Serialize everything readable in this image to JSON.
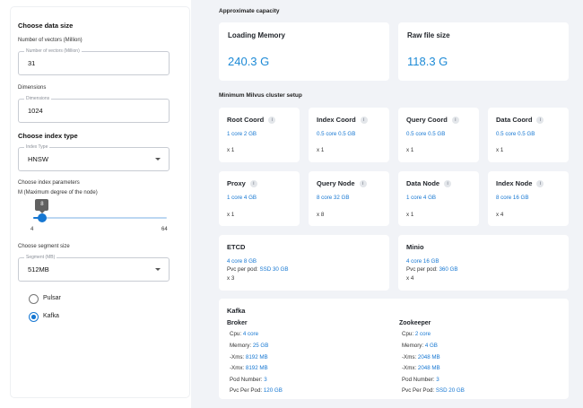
{
  "left": {
    "data_size_title": "Choose data size",
    "vectors_label": "Number of vectors (Million)",
    "vectors_legend": "Number of vectors (Million)",
    "vectors_value": "31",
    "dimensions_label": "Dimensions",
    "dimensions_legend": "Dimensions",
    "dimensions_value": "1024",
    "index_type_title": "Choose index type",
    "index_type_legend": "Index Type",
    "index_type_value": "HNSW",
    "index_params_label": "Choose index parameters",
    "m_label": "M (Maximum degree of the node)",
    "m_value": "8",
    "m_value_fraction": 0.067,
    "m_min": "4",
    "m_max": "64",
    "segment_label": "Choose segment size",
    "segment_legend": "Segment (MB)",
    "segment_value": "512MB",
    "mq_options": [
      {
        "label": "Pulsar",
        "selected": false
      },
      {
        "label": "Kafka",
        "selected": true
      }
    ]
  },
  "right": {
    "capacity_title": "Approximate capacity",
    "loading_memory": {
      "name": "Loading Memory",
      "value": "240.3 G"
    },
    "raw_file_size": {
      "name": "Raw file size",
      "value": "118.3 G"
    },
    "cluster_title": "Minimum Milvus cluster setup",
    "nodes": [
      {
        "name": "Root Coord",
        "spec": "1 core 2 GB",
        "count": "x 1"
      },
      {
        "name": "Index Coord",
        "spec": "0.5 core 0.5 GB",
        "count": "x 1"
      },
      {
        "name": "Query Coord",
        "spec": "0.5 core 0.5 GB",
        "count": "x 1"
      },
      {
        "name": "Data Coord",
        "spec": "0.5 core 0.5 GB",
        "count": "x 1"
      },
      {
        "name": "Proxy",
        "spec": "1 core 4 GB",
        "count": "x 1"
      },
      {
        "name": "Query Node",
        "spec": "8 core 32 GB",
        "count": "x 8"
      },
      {
        "name": "Data Node",
        "spec": "1 core 4 GB",
        "count": "x 1"
      },
      {
        "name": "Index Node",
        "spec": "8 core 16 GB",
        "count": "x 4"
      }
    ],
    "etcd": {
      "name": "ETCD",
      "spec": "4 core 8 GB",
      "pvc_label": "Pvc per pod:",
      "pvc_value": "SSD 30 GB",
      "count": "x 3"
    },
    "minio": {
      "name": "Minio",
      "spec": "4 core 16 GB",
      "pvc_label": "Pvc per pod:",
      "pvc_value": "360 GB",
      "count": "x 4"
    },
    "kafka": {
      "title": "Kafka",
      "broker": {
        "title": "Broker",
        "rows": [
          {
            "label": "Cpu:",
            "value": "4 core"
          },
          {
            "label": "Memory:",
            "value": "25 GB"
          },
          {
            "label": "-Xms:",
            "value": "8192 MB"
          },
          {
            "label": "-Xmx:",
            "value": "8192 MB"
          },
          {
            "label": "Pod Number:",
            "value": "3"
          },
          {
            "label": "Pvc Per Pod:",
            "value": "120 GB"
          }
        ]
      },
      "zookeeper": {
        "title": "Zookeeper",
        "rows": [
          {
            "label": "Cpu:",
            "value": "2 core"
          },
          {
            "label": "Memory:",
            "value": "4 GB"
          },
          {
            "label": "-Xms:",
            "value": "2048 MB"
          },
          {
            "label": "-Xmx:",
            "value": "2048 MB"
          },
          {
            "label": "Pod Number:",
            "value": "3"
          },
          {
            "label": "Pvc Per Pod:",
            "value": "SSD 20 GB"
          }
        ]
      }
    }
  },
  "colors": {
    "accent": "#1677d2",
    "big_value": "#1d8ad6",
    "panel_bg": "#f1f3f7"
  },
  "icons": {
    "info": "info-icon",
    "select_caret": "chevron-down-icon"
  }
}
